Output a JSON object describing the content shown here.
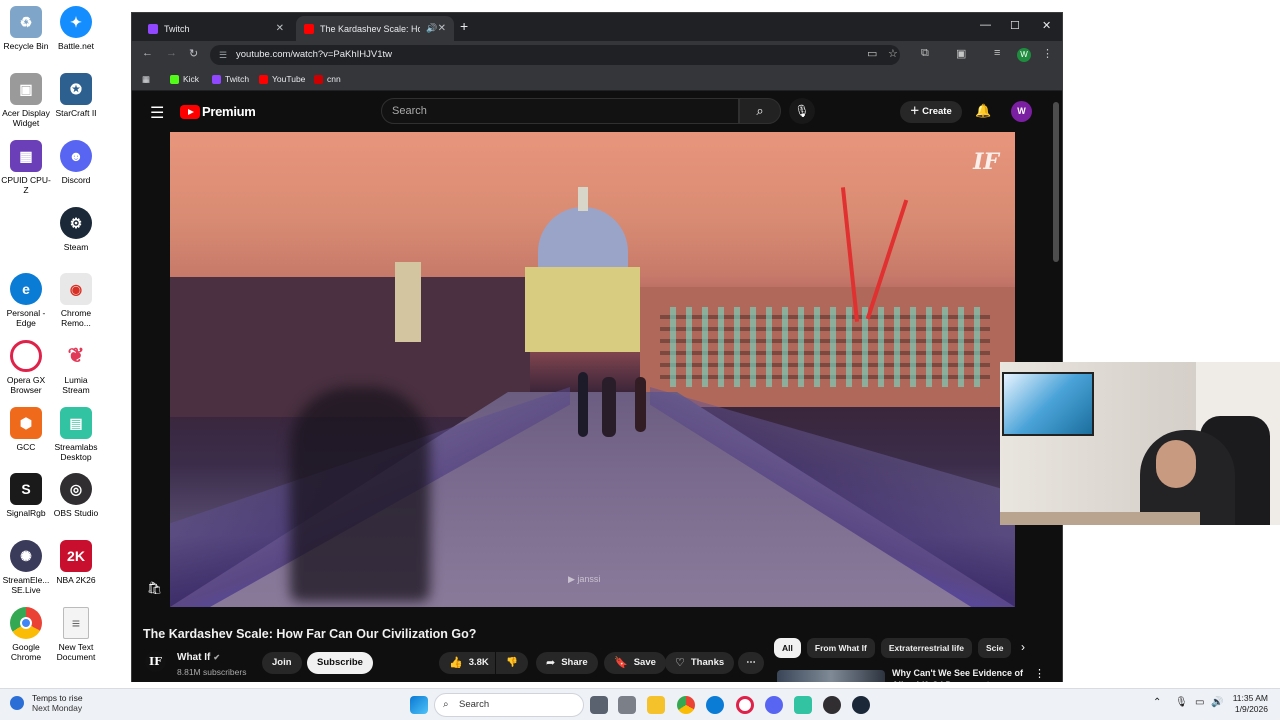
{
  "desktop": {
    "icons": [
      {
        "label": "Recycle Bin",
        "color": "#7fa6c9"
      },
      {
        "label": "Battle.net",
        "color": "#148eff"
      },
      {
        "label": "Acer Display Widget",
        "color": "#9a9a9a"
      },
      {
        "label": "StarCraft II",
        "color": "#2d5f8f"
      },
      {
        "label": "CPUID CPU-Z",
        "color": "#6a3fb8"
      },
      {
        "label": "Discord",
        "color": "#5865f2"
      },
      {
        "label": "Steam",
        "color": "#1b2838"
      },
      {
        "label": "Personal - Edge",
        "color": "#0a7cd6"
      },
      {
        "label": "Chrome Remo...",
        "color": "#e8e8e8"
      },
      {
        "label": "Opera GX Browser",
        "color": "#e0224a"
      },
      {
        "label": "Lumia Stream",
        "color": "#e03a58"
      },
      {
        "label": "GCC",
        "color": "#f06a1c"
      },
      {
        "label": "Streamlabs Desktop",
        "color": "#31c3a2"
      },
      {
        "label": "SignalRgb",
        "color": "#1a1a1a"
      },
      {
        "label": "OBS Studio",
        "color": "#302e31"
      },
      {
        "label": "StreamEle... SE.Live",
        "color": "#3a3a5a"
      },
      {
        "label": "NBA 2K26",
        "color": "#c8102e"
      },
      {
        "label": "Google Chrome",
        "color": "#4285f4"
      },
      {
        "label": "New Text Document",
        "color": "#f4f4f4"
      }
    ]
  },
  "browser": {
    "tabs": [
      {
        "label": "Twitch",
        "active": false
      },
      {
        "label": "The Kardashev Scale: How I",
        "active": true
      }
    ],
    "url": "youtube.com/watch?v=PaKhIHJV1tw",
    "profile_initial": "W",
    "bookmarks": [
      "Kick",
      "Twitch",
      "YouTube",
      "cnn"
    ]
  },
  "youtube": {
    "brand": "Premium",
    "search_placeholder": "Search",
    "create_label": "Create",
    "avatar_initial": "W",
    "video": {
      "title": "The Kardashev Scale: How Far Can Our Civilization Go?",
      "watermark": "janssi",
      "logo_mark": "IF"
    },
    "channel": {
      "name": "What If",
      "avatar_initial": "IF",
      "subscribers": "8.81M subscribers",
      "join_label": "Join",
      "subscribe_label": "Subscribe"
    },
    "actions": {
      "likes": "3.8K",
      "share_label": "Share",
      "save_label": "Save",
      "thanks_label": "Thanks"
    },
    "chips": [
      "All",
      "From What If",
      "Extraterrestrial life",
      "Scie"
    ],
    "recommended": {
      "title": "Why Can't We See Evidence of Alien Life? | Documentary"
    }
  },
  "taskbar": {
    "weather_line1": "Temps to rise",
    "weather_line2": "Next Monday",
    "search_label": "Search",
    "time": "11:35 AM",
    "date": "1/9/2026"
  }
}
